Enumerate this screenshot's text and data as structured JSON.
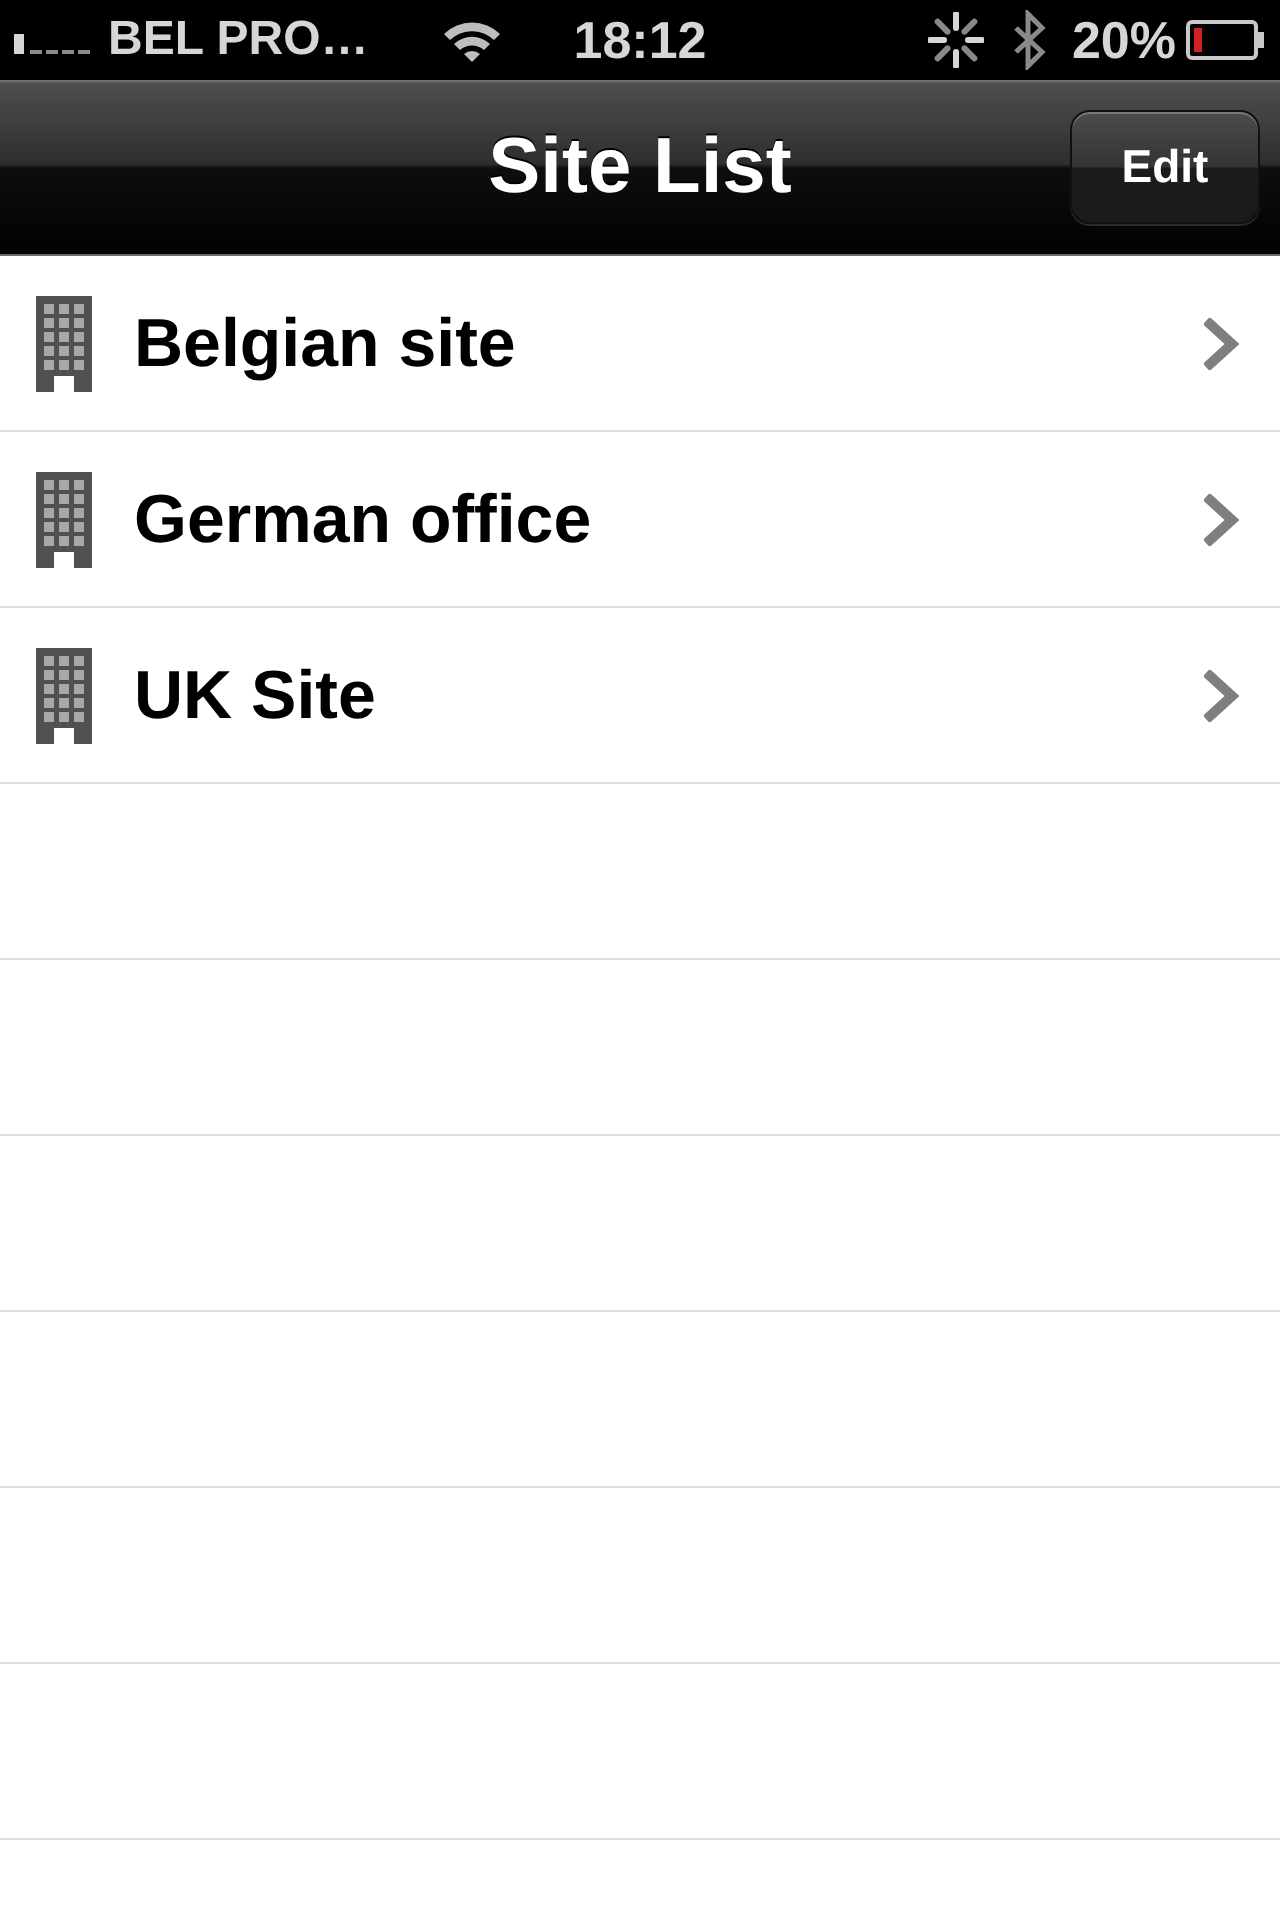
{
  "status_bar": {
    "carrier": "BEL PRO…",
    "time": "18:12",
    "battery": "20%"
  },
  "nav_bar": {
    "title": "Site List",
    "edit_button": "Edit"
  },
  "sites": [
    {
      "name": "Belgian site"
    },
    {
      "name": "German office"
    },
    {
      "name": "UK Site"
    }
  ]
}
